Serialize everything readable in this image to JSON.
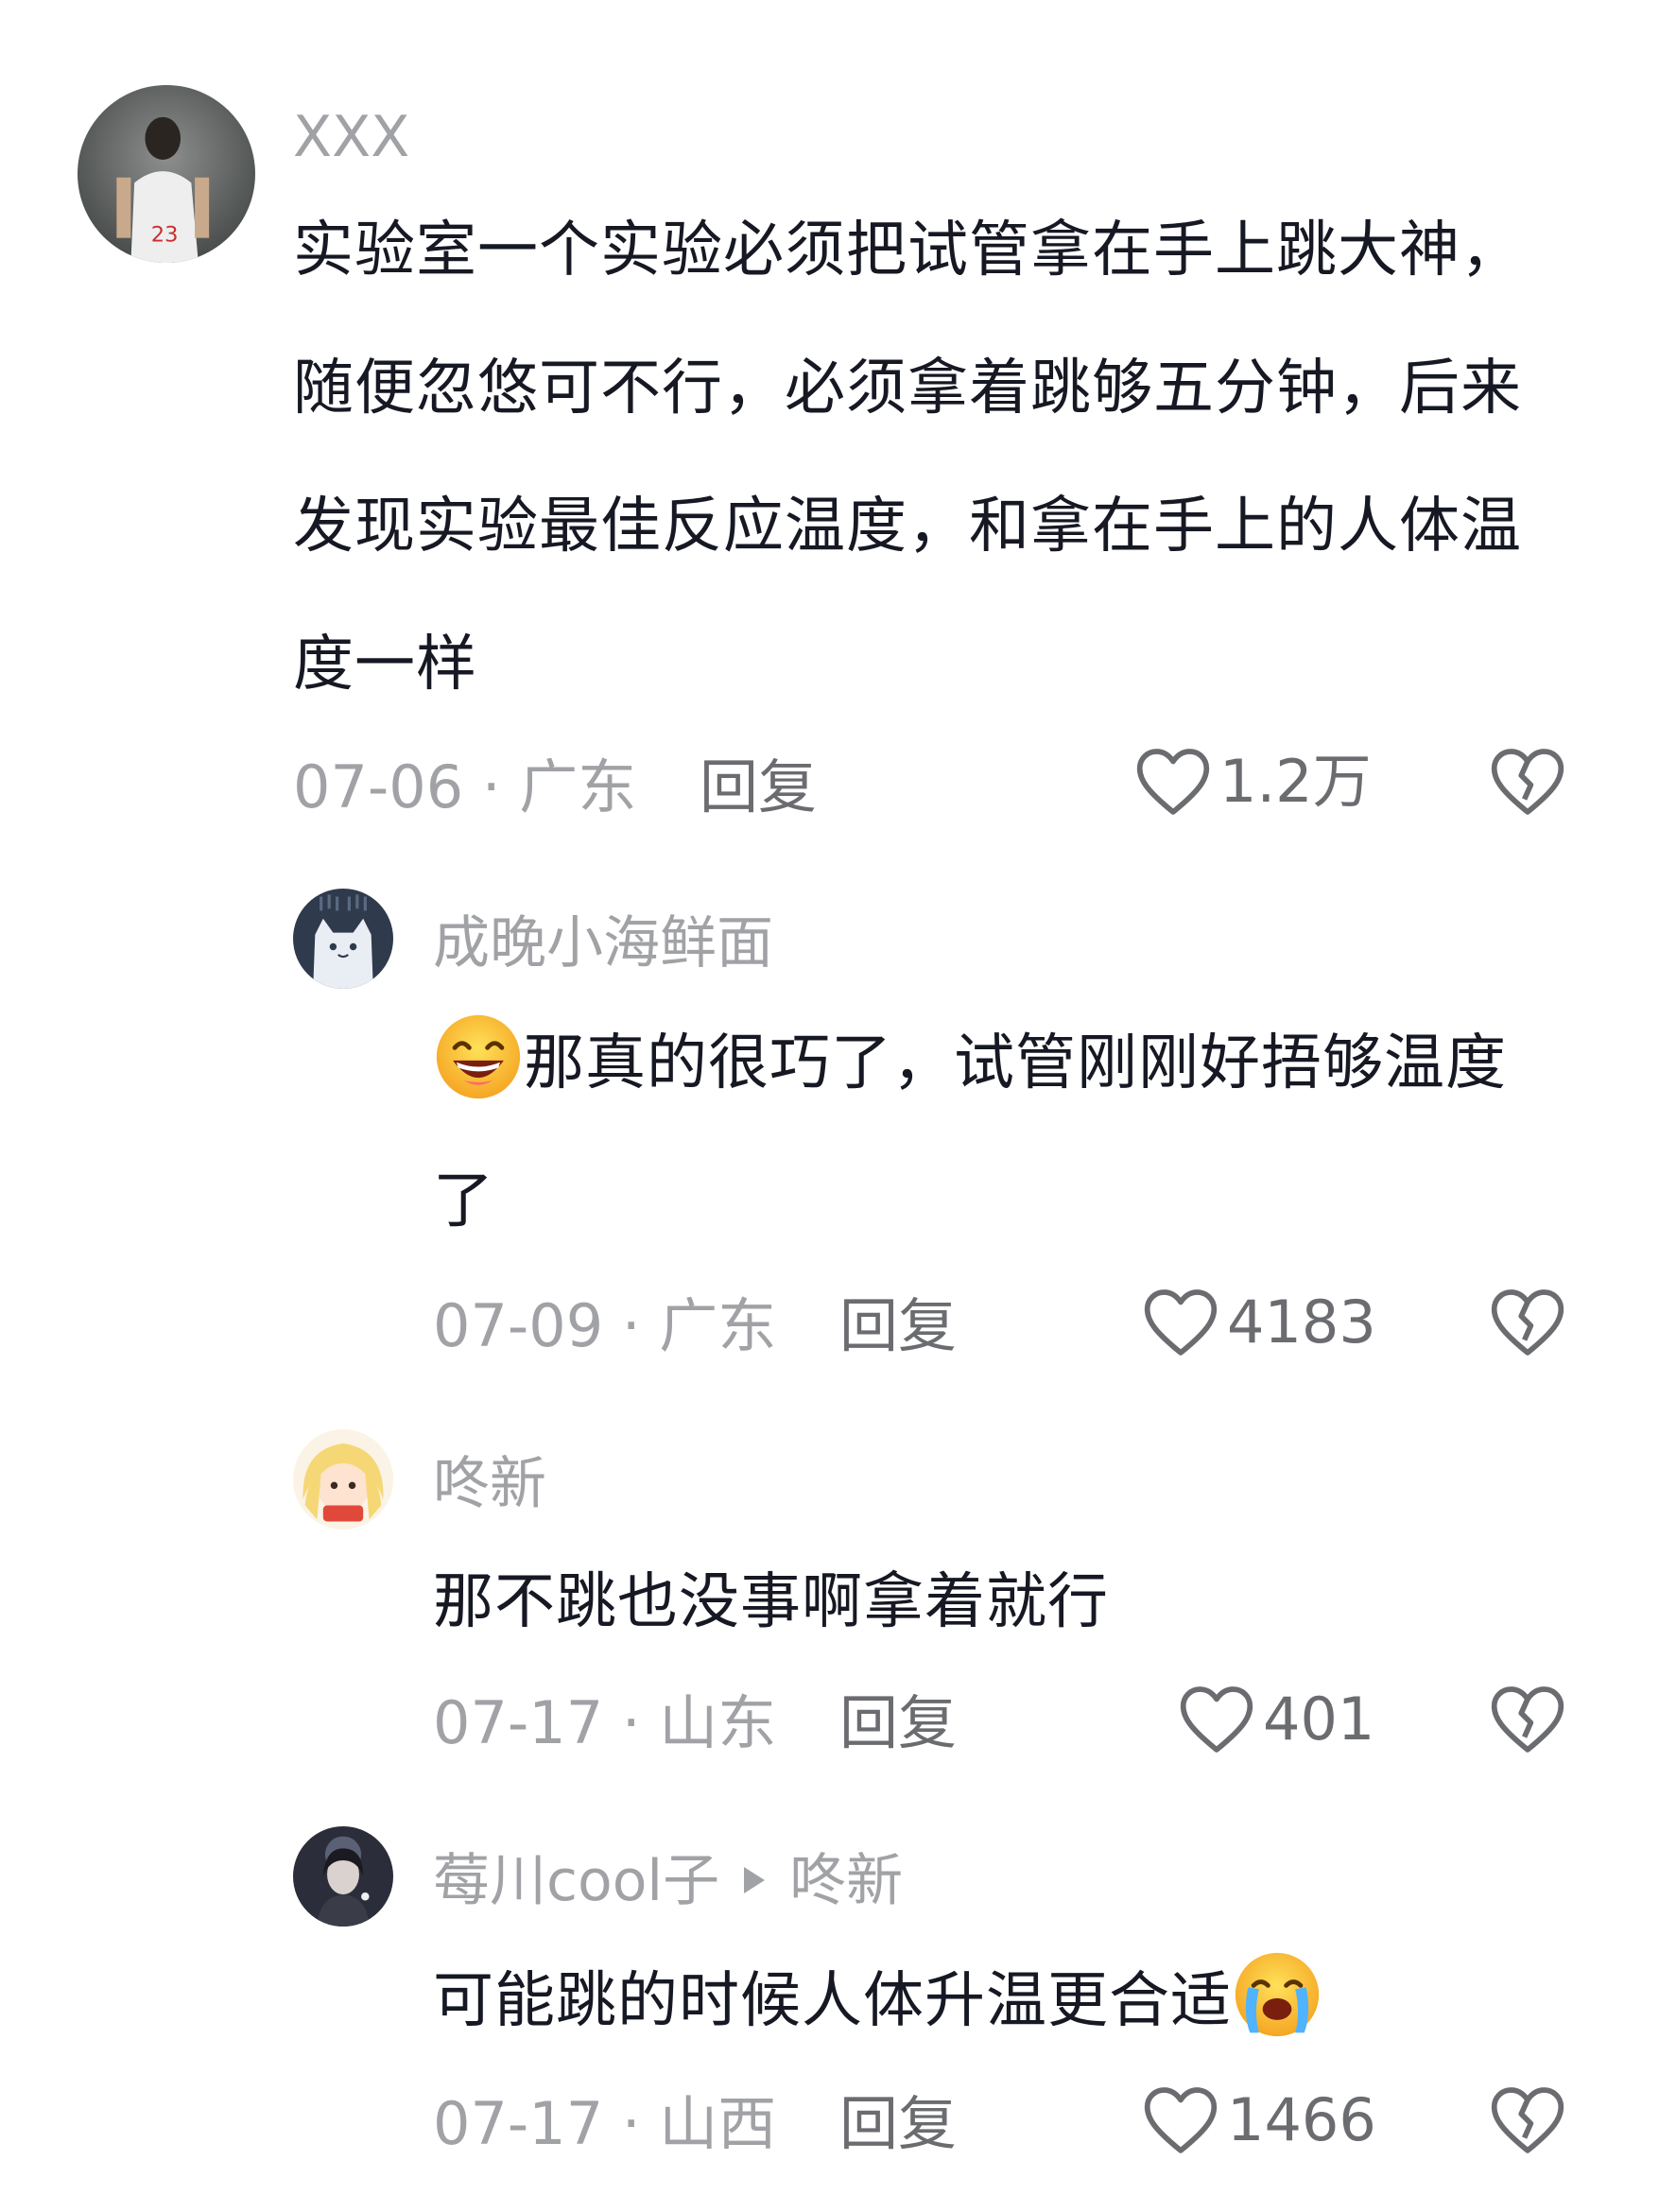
{
  "comments": [
    {
      "username": "XXX",
      "text": "实验室一个实验必须把试管拿在手上跳大神，随便忽悠可不行，必须拿着跳够五分钟，后来发现实验最佳反应温度，和拿在手上的人体温度一样",
      "date_location": "07-06 · 广东",
      "reply_label": "回复",
      "like_count": "1.2万"
    },
    {
      "username": "成晚小海鲜面",
      "emoji": "grinning-squint-face",
      "text": "那真的很巧了，试管刚刚好捂够温度了",
      "date_location": "07-09 · 广东",
      "reply_label": "回复",
      "like_count": "4183"
    },
    {
      "username": "咚新",
      "text": "那不跳也没事啊拿着就行",
      "date_location": "07-17 · 山东",
      "reply_label": "回复",
      "like_count": "401"
    },
    {
      "username": "莓川cool子",
      "reply_to": "咚新",
      "text": "可能跳的时候人体升温更合适",
      "emoji": "loudly-crying-face",
      "date_location": "07-17 · 山西",
      "reply_label": "回复",
      "like_count": "1466"
    }
  ],
  "colors": {
    "meta_gray": "#a1a2a6",
    "text_dark": "#161823",
    "action_gray": "#6b6c70"
  }
}
